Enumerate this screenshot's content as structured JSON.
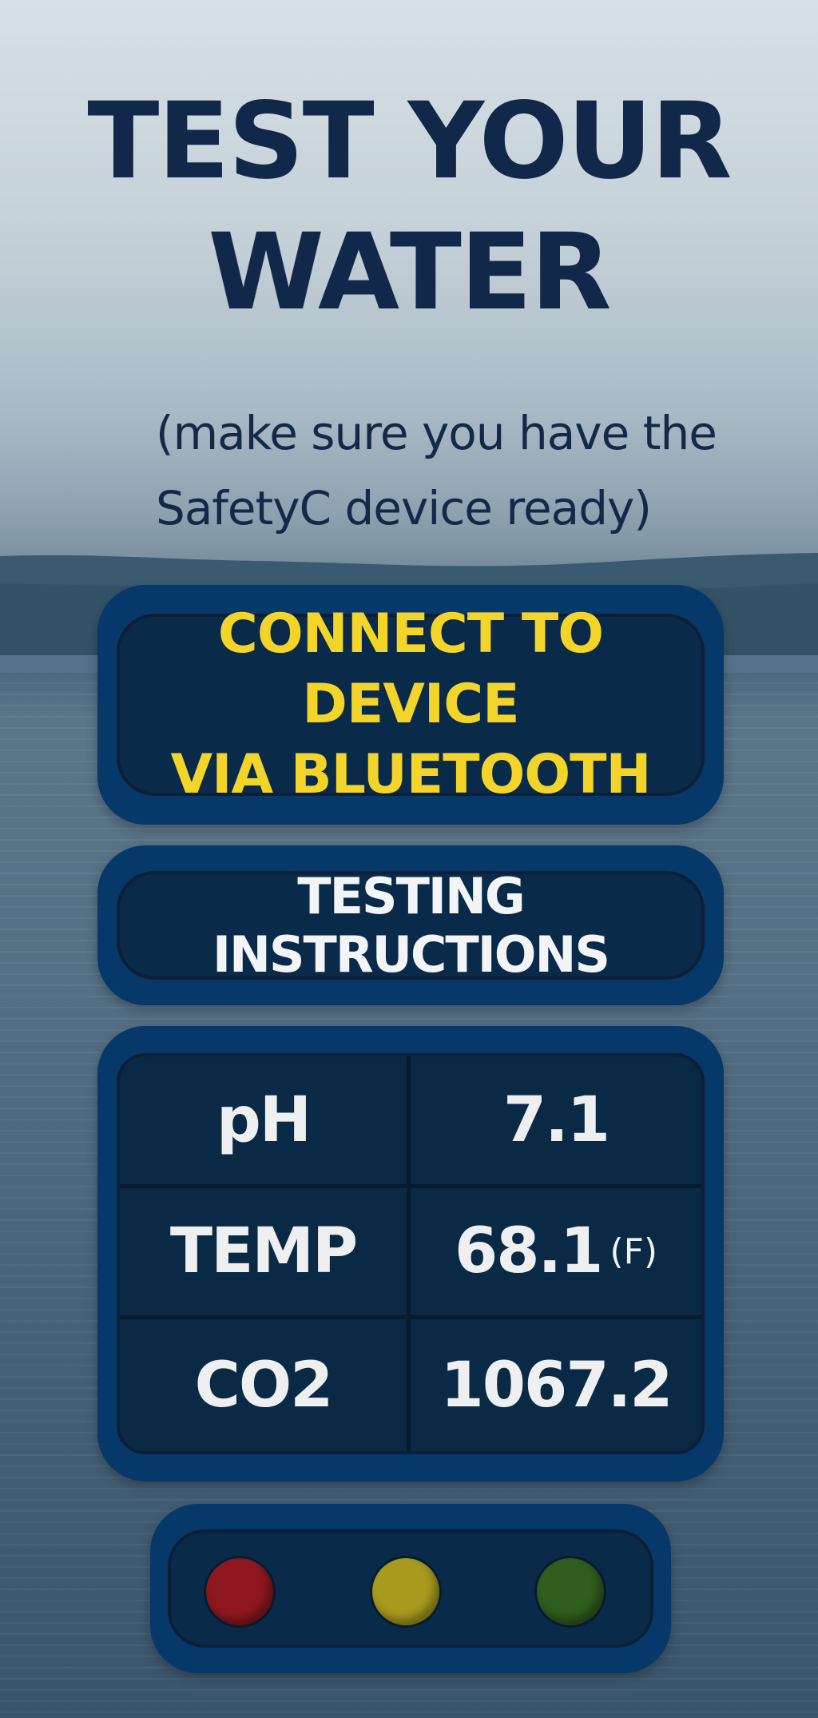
{
  "header": {
    "title_line1": "TEST YOUR",
    "title_line2": "WATER",
    "subtitle_line1": "(make sure you have the",
    "subtitle_line2": "SafetyC device ready)"
  },
  "connect_button": {
    "label_line1": "CONNECT TO DEVICE",
    "label_line2": "VIA BLUETOOTH"
  },
  "instructions_button": {
    "label": "TESTING INSTRUCTIONS"
  },
  "readings": [
    {
      "label": "pH",
      "value": "7.1",
      "unit": ""
    },
    {
      "label": "TEMP",
      "value": "68.1",
      "unit": "(F)"
    },
    {
      "label": "CO2",
      "value": "1067.2",
      "unit": ""
    }
  ],
  "status_lights": [
    {
      "name": "red",
      "color": "#8f1820"
    },
    {
      "name": "yellow",
      "color": "#a89a1e"
    },
    {
      "name": "green",
      "color": "#2f5e1e"
    }
  ],
  "colors": {
    "title_text": "#12284a",
    "button_text_accent": "#f3d52a",
    "panel_bg": "#0a2a4a",
    "panel_border": "#07386a"
  }
}
